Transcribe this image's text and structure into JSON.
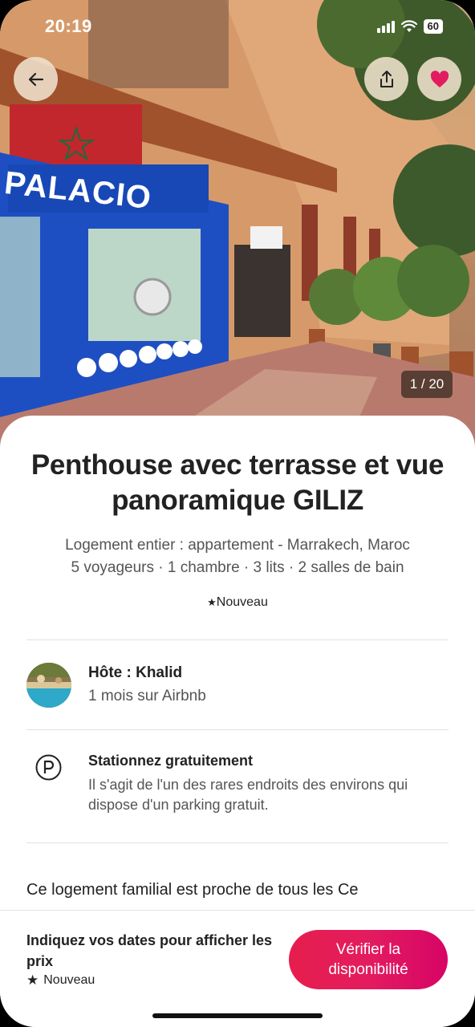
{
  "status_bar": {
    "time": "20:19",
    "battery": "60"
  },
  "photo": {
    "counter": "1 / 20",
    "sign_text": "PALACIO"
  },
  "listing": {
    "title": "Penthouse avec terrasse et vue panoramique GILIZ",
    "subtitle_line1": "Logement entier : appartement - Marrakech, Maroc",
    "subtitle_line2": "5 voyageurs · 1 chambre · 3 lits · 2 salles de bain",
    "badge": "Nouveau"
  },
  "host": {
    "title": "Hôte : Khalid",
    "subtitle": "1 mois sur Airbnb"
  },
  "highlight": {
    "title": "Stationnez gratuitement",
    "description": "Il s'agit de l'un des rares endroits des environs qui dispose d'un parking gratuit."
  },
  "description_preview": "Ce logement familial est proche de tous les Ce",
  "footer": {
    "prompt": "Indiquez vos dates pour afficher les prix",
    "badge": "Nouveau",
    "cta_label": "Vérifier la disponibilité"
  },
  "icons": {
    "back": "arrow-left-icon",
    "share": "share-icon",
    "favorite": "heart-icon",
    "parking": "parking-icon",
    "star": "star-icon"
  },
  "colors": {
    "accent": "#e31c5f",
    "heart": "#e31c5f"
  }
}
